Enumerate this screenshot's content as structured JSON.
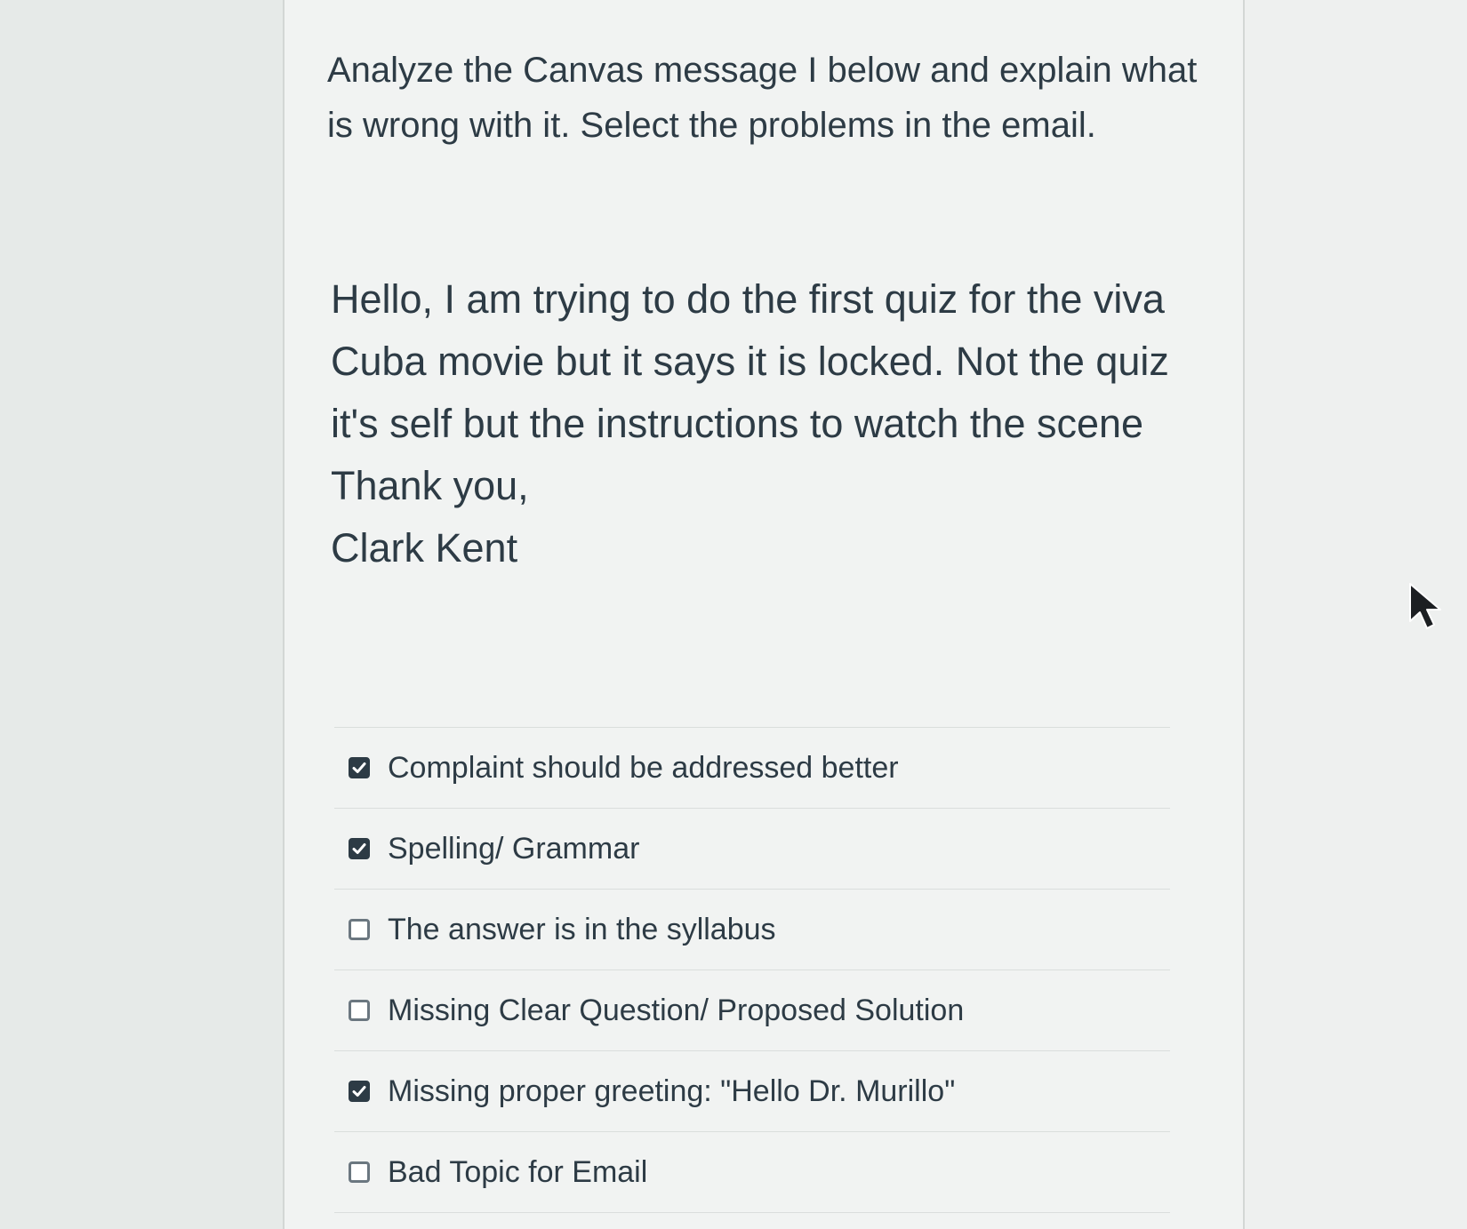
{
  "question": {
    "text": "Analyze the Canvas message I below and explain what is wrong with it. Select the problems in the email."
  },
  "message": {
    "body": "Hello, I am trying to do the first quiz for the viva Cuba movie but it says it is locked. Not the quiz it's self but the instructions to watch the scene",
    "closing": "Thank you,",
    "signature": "Clark Kent"
  },
  "answers": [
    {
      "label": "Complaint should be addressed better",
      "checked": true
    },
    {
      "label": "Spelling/ Grammar",
      "checked": true
    },
    {
      "label": "The answer is in the syllabus",
      "checked": false
    },
    {
      "label": "Missing Clear Question/ Proposed Solution",
      "checked": false
    },
    {
      "label": "Missing proper greeting: \"Hello Dr. Murillo\"",
      "checked": true
    },
    {
      "label": "Bad Topic for Email",
      "checked": false
    }
  ],
  "icons": {
    "checkbox_checked": "checkmark-icon",
    "pointer": "mouse-pointer-icon"
  },
  "colors": {
    "text": "#2d3b45",
    "checkbox_checked_fill": "#2d3b45",
    "checkbox_unchecked_border": "#6b7780",
    "page_background": "#f1f3f2"
  }
}
